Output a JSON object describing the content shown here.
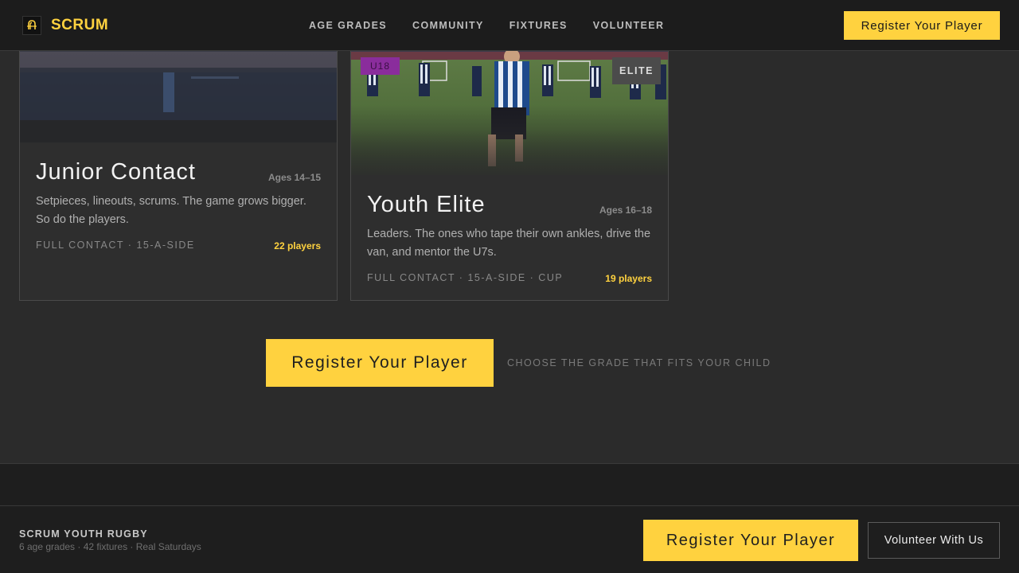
{
  "header": {
    "brand": "SCRUM",
    "nav": [
      "AGE GRADES",
      "COMMUNITY",
      "FIXTURES",
      "VOLUNTEER"
    ],
    "cta_label": "Register Your Player"
  },
  "cards": [
    {
      "title": "Junior Contact",
      "ages": "Ages 14–15",
      "description": "Setpieces, lineouts, scrums. The game grows bigger. So do the players.",
      "meta": "FULL CONTACT · 15-A-SIDE",
      "count": "22 players"
    },
    {
      "badge": "U18",
      "badge_color": "#8a2d9c",
      "tier": "ELITE",
      "title": "Youth Elite",
      "ages": "Ages 16–18",
      "description": "Leaders. The ones who tape their own ankles, drive the van, and mentor the U7s.",
      "meta": "FULL CONTACT · 15-A-SIDE · CUP",
      "count": "19 players"
    }
  ],
  "cta_section": {
    "button_label": "Register Your Player",
    "note": "CHOOSE THE GRADE THAT FITS YOUR CHILD"
  },
  "footer": {
    "name": "SCRUM YOUTH RUGBY",
    "summary": "6 age grades · 42 fixtures · Real Saturdays",
    "register_label": "Register Your Player",
    "volunteer_label": "Volunteer With Us"
  },
  "colors": {
    "accent": "#ffd23f",
    "background": "#2b2b2b",
    "nav_bg": "#1c1c1c"
  }
}
